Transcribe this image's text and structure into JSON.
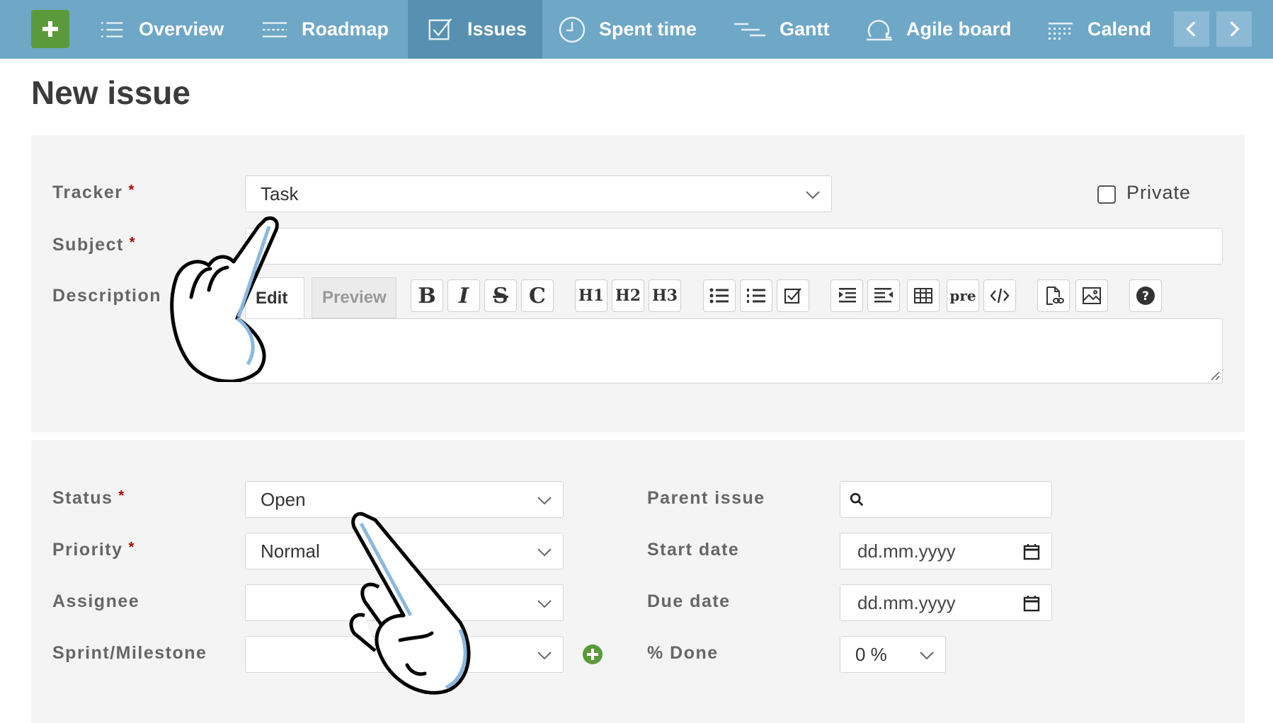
{
  "nav": {
    "items": [
      {
        "label": "Overview",
        "icon": "list-icon"
      },
      {
        "label": "Roadmap",
        "icon": "roadmap-icon"
      },
      {
        "label": "Issues",
        "icon": "checkbox-icon",
        "active": true
      },
      {
        "label": "Spent time",
        "icon": "clock-icon"
      },
      {
        "label": "Gantt",
        "icon": "gantt-icon"
      },
      {
        "label": "Agile board",
        "icon": "agile-icon"
      },
      {
        "label": "Calend",
        "icon": "calendar-icon"
      }
    ],
    "colors": {
      "bar": "#6fa7c7",
      "active": "#5790b0",
      "add": "#5b9a3a"
    }
  },
  "page": {
    "title": "New issue"
  },
  "form": {
    "tracker": {
      "label": "Tracker",
      "required": "*",
      "value": "Task"
    },
    "private": {
      "label": "Private",
      "checked": false
    },
    "subject": {
      "label": "Subject",
      "required": "*",
      "value": ""
    },
    "description": {
      "label": "Description",
      "tabs": {
        "edit": "Edit",
        "preview": "Preview"
      },
      "toolbar": {
        "bold": "B",
        "italic": "I",
        "strike": "S",
        "code": "C",
        "h1": "H1",
        "h2": "H2",
        "h3": "H3",
        "pre": "pre"
      }
    },
    "status": {
      "label": "Status",
      "required": "*",
      "value": "Open"
    },
    "priority": {
      "label": "Priority",
      "required": "*",
      "value": "Normal"
    },
    "assignee": {
      "label": "Assignee",
      "value": ""
    },
    "sprint": {
      "label": "Sprint/Milestone",
      "value": ""
    },
    "parent_issue": {
      "label": "Parent issue",
      "value": ""
    },
    "start_date": {
      "label": "Start date",
      "placeholder": "dd.mm.yyyy"
    },
    "due_date": {
      "label": "Due date",
      "placeholder": "dd.mm.yyyy"
    },
    "done": {
      "label": "% Done",
      "value": "0 %"
    }
  }
}
